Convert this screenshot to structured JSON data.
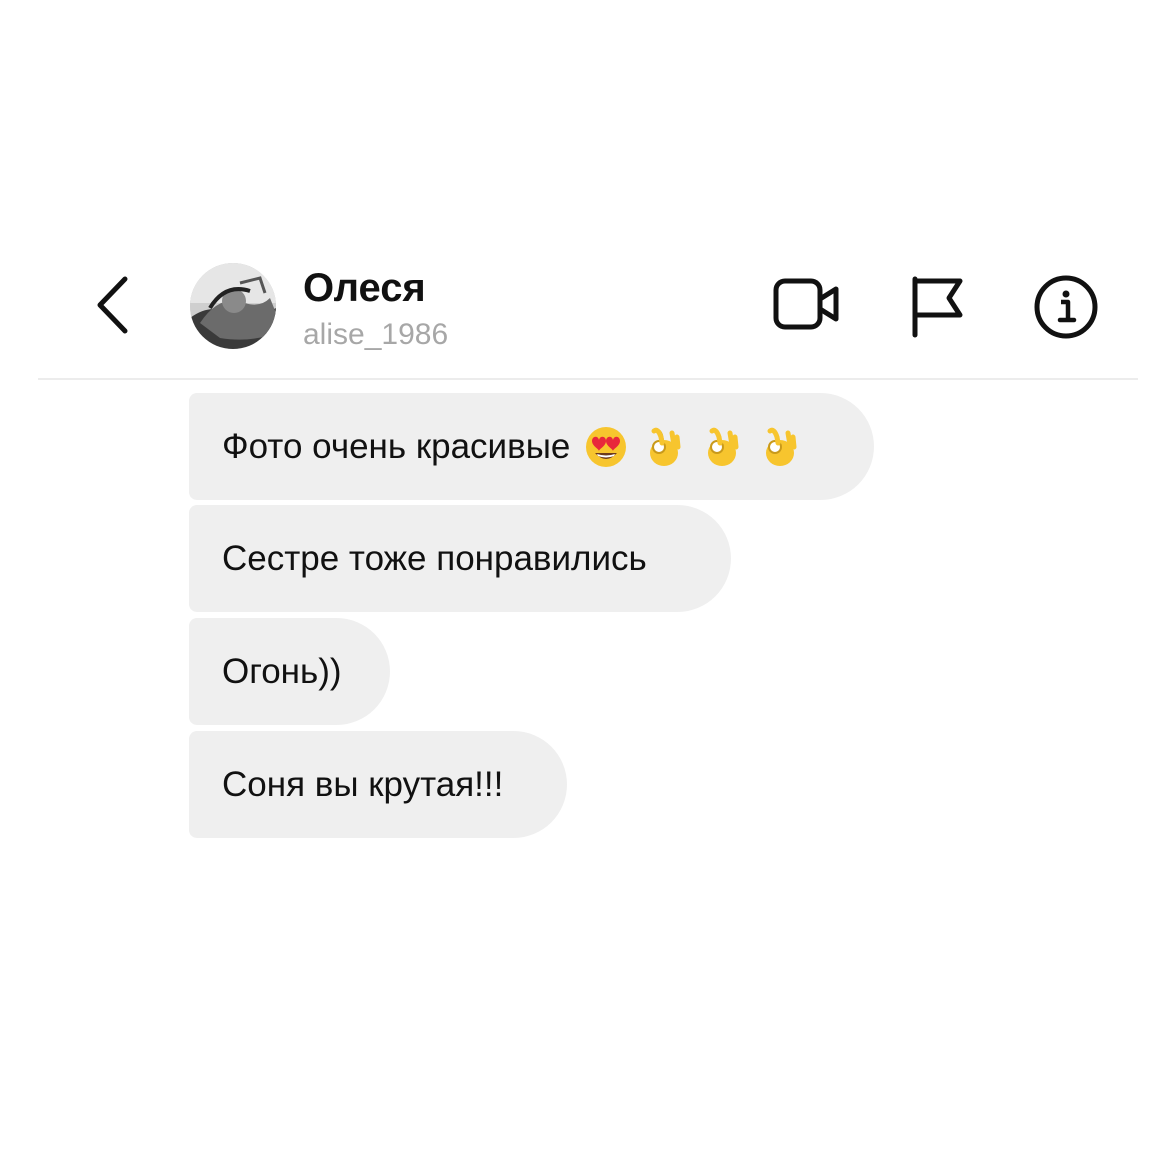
{
  "header": {
    "back_icon": "chevron-left-icon",
    "avatar_icon": "profile-photo",
    "contact_name": "Олеся",
    "contact_username": "alise_1986",
    "video_icon": "video-camera-icon",
    "flag_icon": "flag-icon",
    "info_icon": "info-icon"
  },
  "messages": [
    {
      "text": "Фото очень красивые",
      "emojis": [
        "heart-eyes-emoji",
        "ok-hand-emoji",
        "ok-hand-emoji",
        "ok-hand-emoji"
      ]
    },
    {
      "text": "Сестре тоже понравились"
    },
    {
      "text": "Огонь))"
    },
    {
      "text": "Соня вы крутая!!!"
    }
  ],
  "colors": {
    "bubble_bg": "#efefef",
    "username_gray": "#a7a7a7",
    "text": "#111111",
    "emoji_yellow": "#f7c52e",
    "heart_red": "#e8273b"
  }
}
